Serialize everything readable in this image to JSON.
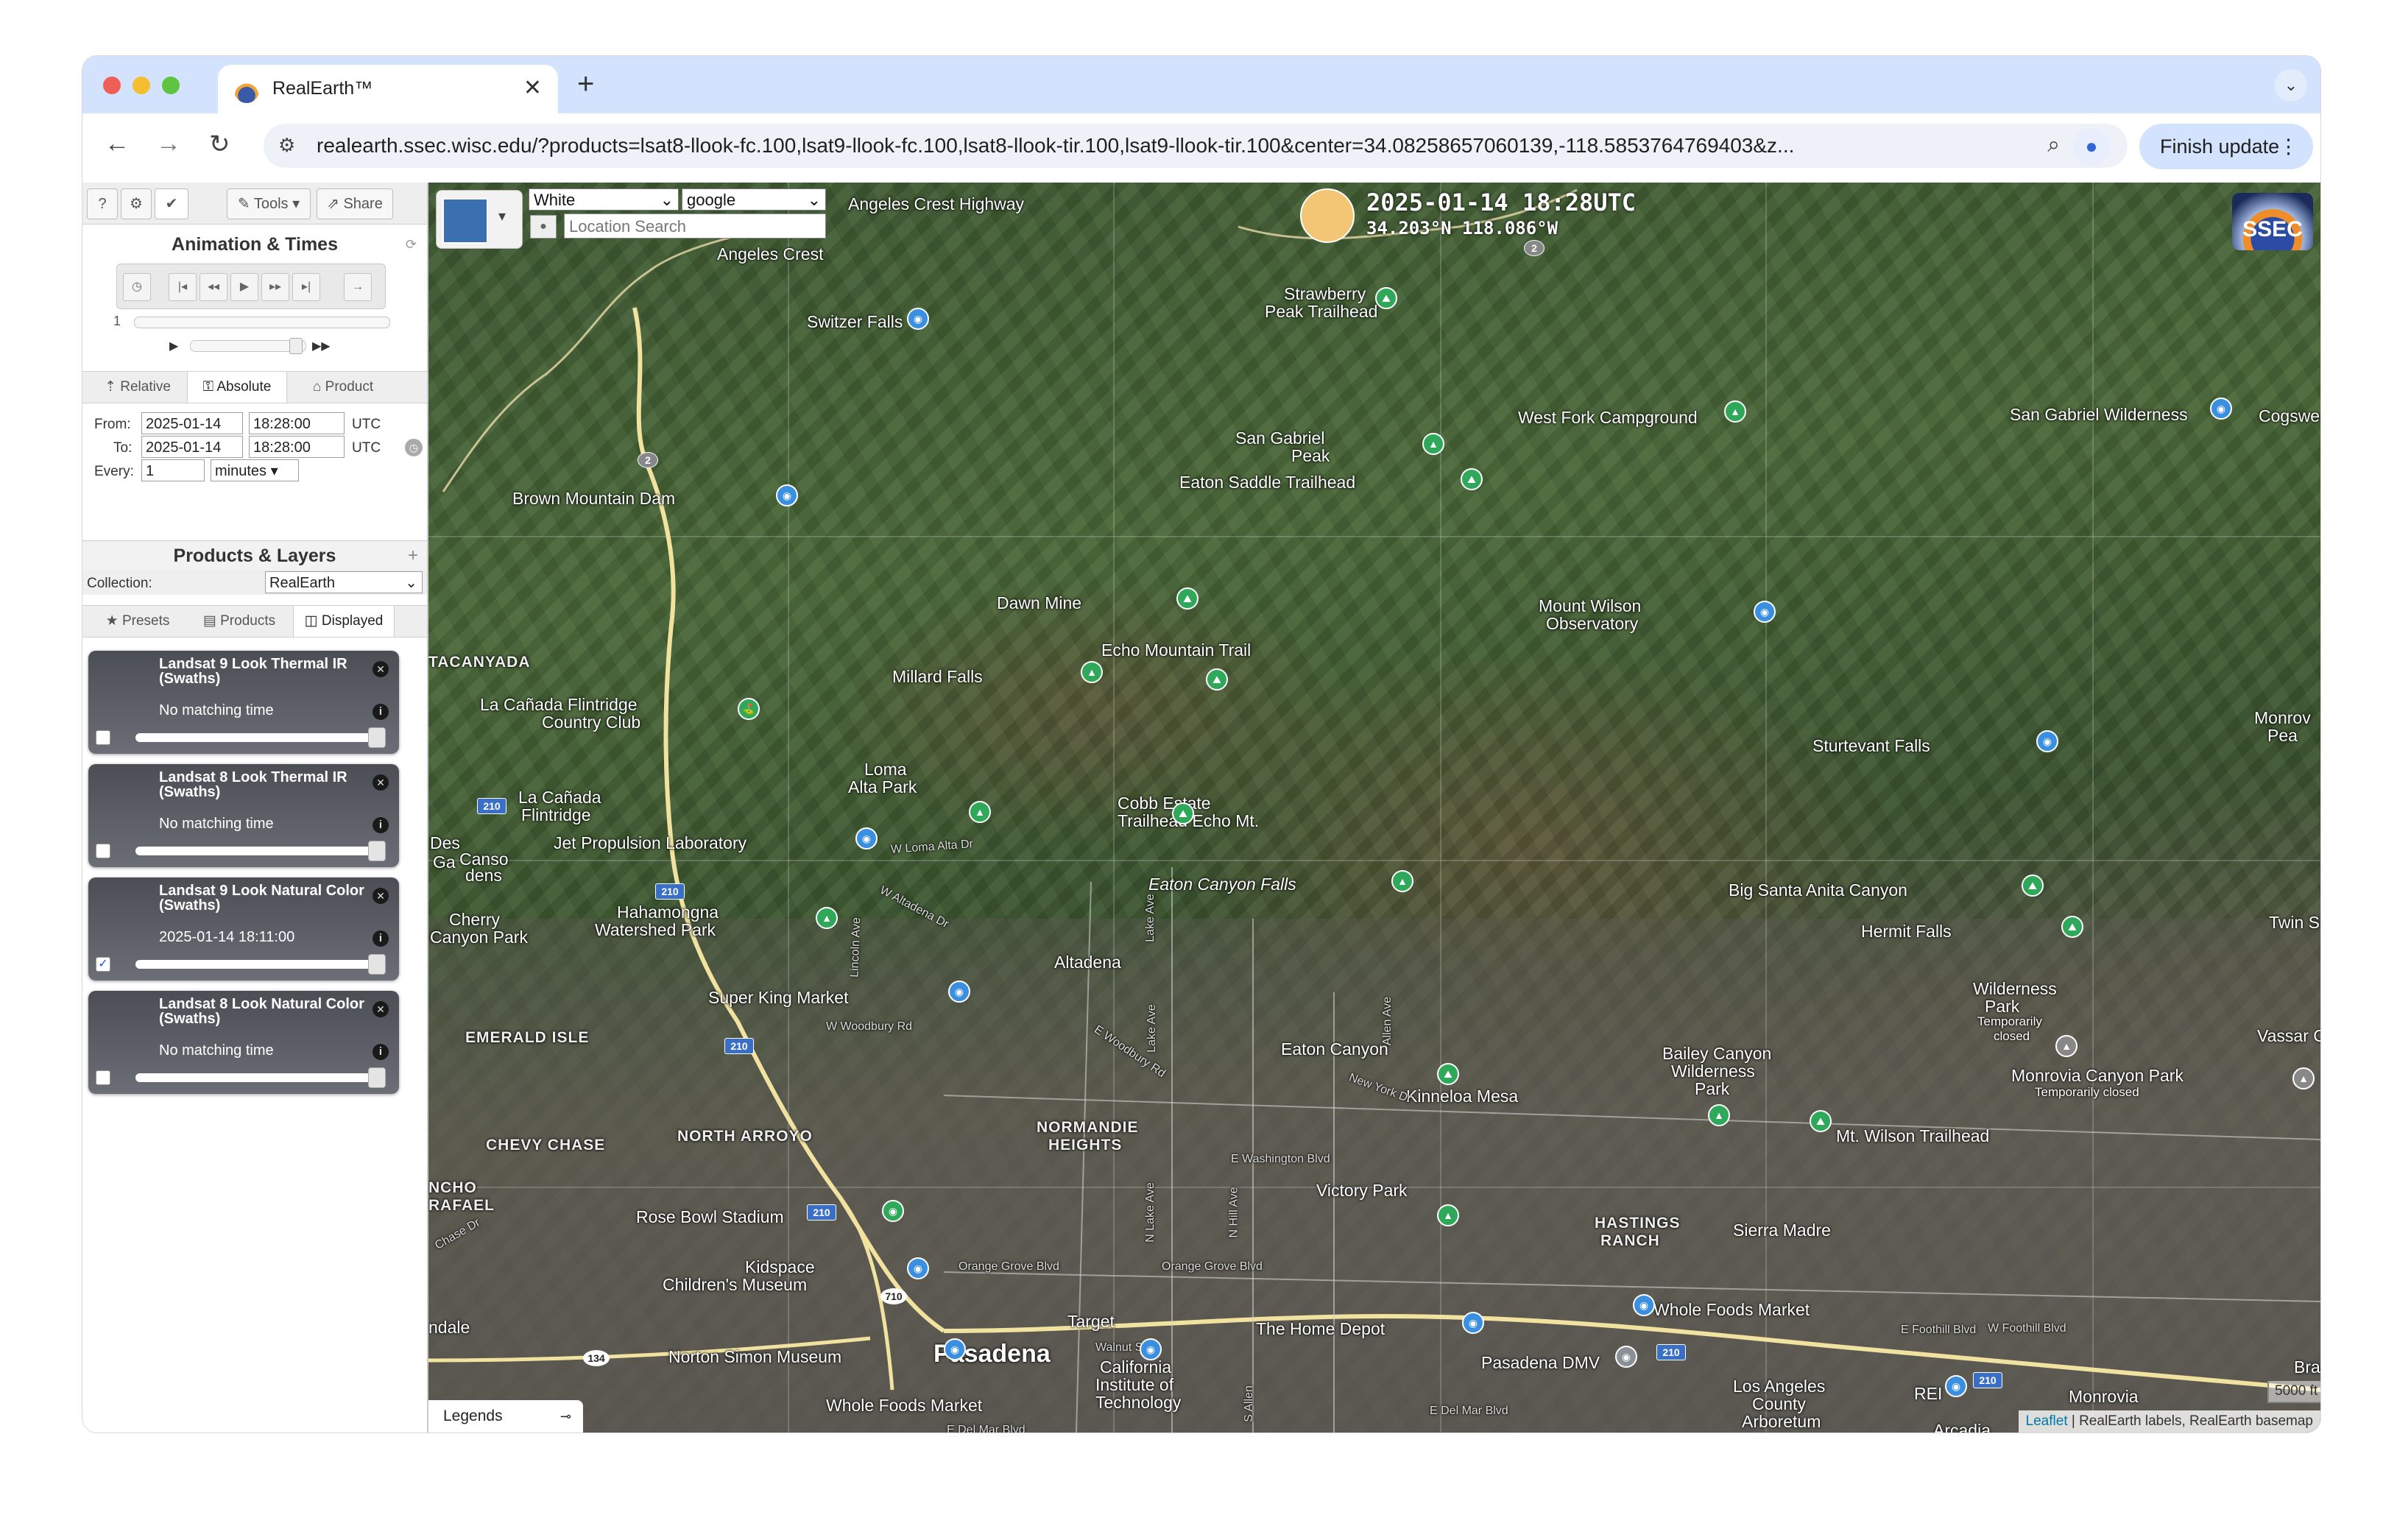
{
  "browser": {
    "tab_title": "RealEarth™",
    "url": "realearth.ssec.wisc.edu/?products=lsat8-llook-fc.100,lsat9-llook-fc.100,lsat8-llook-tir.100,lsat9-llook-tir.100&center=34.08258657060139,-118.5853764769403&z...",
    "update_label": "Finish update"
  },
  "sidebar": {
    "help_label": "?",
    "settings_label": "⚙",
    "check_label": "✔",
    "tools_label": "Tools",
    "share_label": "Share",
    "animation_title": "Animation & Times",
    "frame_number": "1",
    "time_tabs": [
      "Relative",
      "Absolute",
      "Product"
    ],
    "from_label": "From:",
    "to_label": "To:",
    "every_label": "Every:",
    "from_date": "2025-01-14",
    "from_time": "18:28:00",
    "to_date": "2025-01-14",
    "to_time": "18:28:00",
    "tz": "UTC",
    "every_value": "1",
    "every_unit": "minutes",
    "products_title": "Products & Layers",
    "collection_label": "Collection:",
    "collection_value": "RealEarth",
    "layer_tabs": [
      "Presets",
      "Products",
      "Displayed"
    ],
    "layers": [
      {
        "name": "Landsat 9 Look Thermal IR (Swaths)",
        "time": "No matching time",
        "checked": false
      },
      {
        "name": "Landsat 8 Look Thermal IR (Swaths)",
        "time": "No matching time",
        "checked": false
      },
      {
        "name": "Landsat 9 Look Natural Color (Swaths)",
        "time": "2025-01-14 18:11:00",
        "checked": true
      },
      {
        "name": "Landsat 8 Look Natural Color (Swaths)",
        "time": "No matching time",
        "checked": false
      }
    ]
  },
  "map": {
    "basemap_color": "White",
    "basemap_source": "google",
    "search_placeholder": "Location Search",
    "datetime": "2025-01-14 18:28UTC",
    "coords": "34.203°N 118.086°W",
    "logo_text": "SSEC",
    "scale": "5000 ft",
    "attribution_link": "Leaflet",
    "attribution_text": "| RealEarth labels, RealEarth basemap",
    "legends_label": "Legends",
    "labels": {
      "angeles_crest_hwy": "Angeles Crest Highway",
      "angeles_crest": "Angeles Crest",
      "strawberry": "Strawberry",
      "strawberry2": "Peak Trailhead",
      "switzer": "Switzer Falls",
      "west_fork": "West Fork Campground",
      "sg_wilderness": "San Gabriel Wilderness",
      "cogswell": "Cogswe",
      "sg_peak": "San Gabriel",
      "sg_peak2": "Peak",
      "eaton_saddle": "Eaton Saddle Trailhead",
      "brown_dam": "Brown Mountain Dam",
      "dawn_mine": "Dawn Mine",
      "mt_wilson_obs": "Mount Wilson",
      "mt_wilson_obs2": "Observatory",
      "echo_trail": "Echo Mountain Trail",
      "millard": "Millard Falls",
      "tacanyada": "TACANYADA",
      "lcf_cc": "La Cañada Flintridge",
      "lcf_cc2": "Country Club",
      "monrov_pea": "Monrov",
      "monrov_pea2": "Pea",
      "sturtevant": "Sturtevant Falls",
      "loma_alta": "Loma",
      "loma_alta2": "Alta Park",
      "cobb": "Cobb Estate",
      "cobb2": "Trailhead Echo Mt.",
      "lcf": "La Cañada",
      "lcf2": "Flintridge",
      "jpl": "Jet Propulsion Laboratory",
      "des": "Des",
      "canso": "Canso",
      "gag": "Ga",
      "dens": "dens",
      "eaton_falls": "Eaton Canyon Falls",
      "big_santa": "Big Santa Anita Canyon",
      "hermit": "Hermit Falls",
      "twin": "Twin S",
      "hahamongna": "Hahamongna",
      "hahamongna2": "Watershed Park",
      "cherry": "Cherry",
      "cherry2": "Canyon Park",
      "altadena": "Altadena",
      "super_king": "Super King Market",
      "wilderness_park": "Wilderness",
      "wilderness_park2": "Park",
      "wilderness_park3": "Temporarily",
      "wilderness_park4": "closed",
      "vassar": "Vassar C",
      "emerald": "EMERALD ISLE",
      "eaton_canyon": "Eaton Canyon",
      "bailey": "Bailey Canyon",
      "bailey2": "Wilderness",
      "bailey3": "Park",
      "monrovia_cp": "Monrovia Canyon Park",
      "monrovia_cp2": "Temporarily closed",
      "kinneloa": "Kinneloa Mesa",
      "normandie": "NORMANDIE",
      "normandie2": "HEIGHTS",
      "chevy": "CHEVY CHASE",
      "north_arroyo": "NORTH ARROYO",
      "mt_wilson_th": "Mt. Wilson Trailhead",
      "ncho": "NCHO",
      "rafael": "RAFAEL",
      "victory": "Victory Park",
      "hastings": "HASTINGS",
      "hastings2": "RANCH",
      "sierra_madre": "Sierra Madre",
      "rose_bowl": "Rose Bowl Stadium",
      "kidspace": "Kidspace",
      "kidspace2": "Children's Museum",
      "ndale": "ndale",
      "target": "Target",
      "home_depot": "The Home Depot",
      "whole_foods": "Whole Foods Market",
      "norton": "Norton Simon Museum",
      "pasadena": "Pasadena",
      "caltech": "California",
      "caltech2": "Institute of",
      "caltech3": "Technology",
      "dmv": "Pasadena DMV",
      "arboretum": "Los Angeles",
      "arboretum2": "County",
      "arboretum3": "Arboretum",
      "rei": "REI",
      "monrovia": "Monrovia",
      "bra": "Bra",
      "whole_foods2": "Whole Foods Market",
      "arcadia": "Arcadia",
      "road_wloma": "W Loma Alta Dr",
      "road_waltadena": "W Altadena Dr",
      "road_lincoln": "Lincoln Ave",
      "road_lake": "Lake Ave",
      "road_lake2": "Lake Ave",
      "road_allen": "Allen Ave",
      "road_newyork": "New York Dr",
      "road_ewoodbury": "E Woodbury Rd",
      "road_wwoodbury": "W Woodbury Rd",
      "road_ewash": "E Washington Blvd",
      "road_nlake": "N Lake Ave",
      "road_nhill": "N Hill Ave",
      "road_orange1": "Orange Grove Blvd",
      "road_orange2": "Orange Grove Blvd",
      "road_walnut": "Walnut St",
      "road_efoothill": "E Foothill Blvd",
      "road_wfoothill": "W Foothill Blvd",
      "road_edelmar": "E Del Mar Blvd",
      "road_edelmar2": "E Del Mar Blvd",
      "road_sallen": "S Allen",
      "road_chase": "Chase Dr",
      "hwy_2": "2",
      "hwy_2b": "2",
      "hwy_210a": "210",
      "hwy_210b": "210",
      "hwy_210c": "210",
      "hwy_210d": "210",
      "hwy_210e": "210",
      "hwy_210f": "210",
      "hwy_134": "134",
      "hwy_710": "710"
    }
  }
}
